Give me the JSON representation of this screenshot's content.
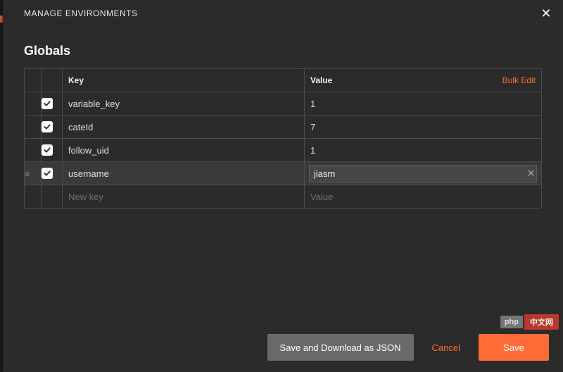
{
  "titlebar": {
    "title": "MANAGE ENVIRONMENTS"
  },
  "section": {
    "heading": "Globals"
  },
  "headers": {
    "key": "Key",
    "value": "Value",
    "bulk_edit": "Bulk Edit"
  },
  "rows": [
    {
      "checked": true,
      "key": "variable_key",
      "value": "1"
    },
    {
      "checked": true,
      "key": "cateId",
      "value": "7"
    },
    {
      "checked": true,
      "key": "follow_uid",
      "value": "1"
    },
    {
      "checked": true,
      "key": "username",
      "value": "jiasm",
      "active": true
    }
  ],
  "placeholders": {
    "key": "New key",
    "value": "Value"
  },
  "footer": {
    "save_download": "Save and Download as JSON",
    "cancel": "Cancel",
    "save": "Save"
  },
  "watermark": {
    "badge": "php",
    "text": "中文网"
  }
}
